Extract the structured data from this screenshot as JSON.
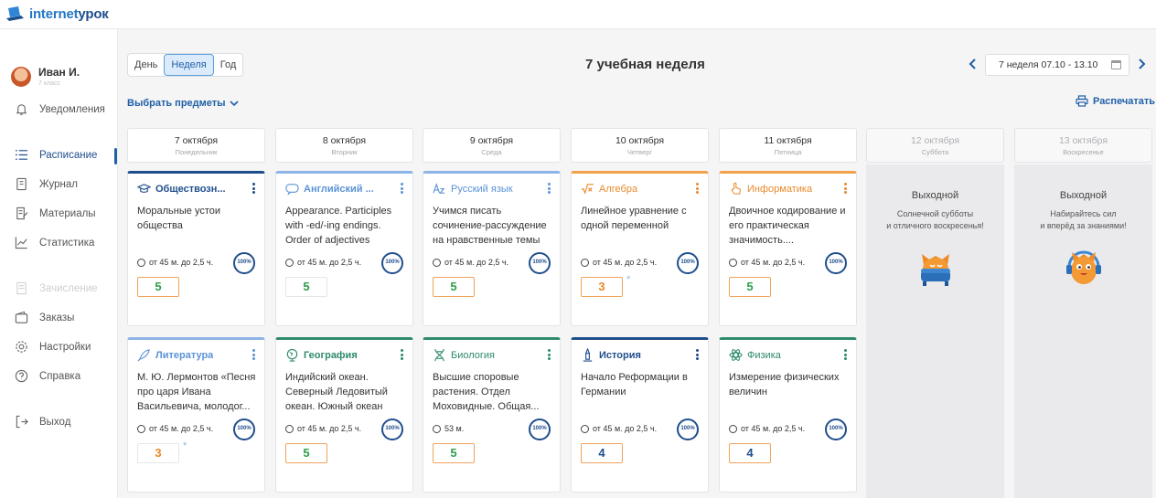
{
  "brand": {
    "name_part1": "internet",
    "name_part2": "урок"
  },
  "user": {
    "name": "Иван И.",
    "class": "7 класс"
  },
  "nav": {
    "notifications": "Уведомления",
    "schedule": "Расписание",
    "journal": "Журнал",
    "materials": "Материалы",
    "statistics": "Статистика",
    "enrollment": "Зачисление",
    "orders": "Заказы",
    "settings": "Настройки",
    "help": "Справка",
    "logout": "Выход"
  },
  "toolbar": {
    "view_day": "День",
    "view_week": "Неделя",
    "view_year": "Год",
    "week_title": "7 учебная неделя",
    "week_range": "7 неделя 07.10 - 13.10",
    "choose_subjects": "Выбрать предметы",
    "print": "Распечатать"
  },
  "days": [
    {
      "date": "7 октября",
      "weekday": "Понедельник"
    },
    {
      "date": "8 октября",
      "weekday": "Вторник"
    },
    {
      "date": "9 октября",
      "weekday": "Среда"
    },
    {
      "date": "10 октября",
      "weekday": "Четверг"
    },
    {
      "date": "11 октября",
      "weekday": "Пятница"
    },
    {
      "date": "12 октября",
      "weekday": "Суббота",
      "off_title": "Выходной",
      "off_line1": "Солнечной субботы",
      "off_line2": "и отличного воскресенья!"
    },
    {
      "date": "13 октября",
      "weekday": "Воскресенье",
      "off_title": "Выходной",
      "off_line1": "Набирайтесь сил",
      "off_line2": "и вперёд за знаниями!"
    }
  ],
  "lessons": {
    "mon1": {
      "subject": "Обществозн...",
      "topic": "Моральные устои общества",
      "duration": "от 45 м. до 2,5 ч.",
      "progress": "100%",
      "grade": "5"
    },
    "mon2": {
      "subject": "Литература",
      "topic": "М. Ю. Лермонтов «Песня про царя Ивана Васильевича, молодог...",
      "duration": "от 45 м. до 2,5 ч.",
      "progress": "100%",
      "grade": "3"
    },
    "tue1": {
      "subject": "Английский ...",
      "topic": "Appearance. Participles with -ed/-ing endings. Order of adjectives",
      "duration": "от 45 м. до 2,5 ч.",
      "progress": "100%",
      "grade": "5"
    },
    "tue2": {
      "subject": "География",
      "topic": "Индийский океан. Северный Ледовитый океан. Южный океан",
      "duration": "от 45 м. до 2,5 ч.",
      "progress": "100%",
      "grade": "5"
    },
    "wed1": {
      "subject": "Русский язык",
      "topic": "Учимся писать сочинение-рассуждение на нравственные темы",
      "duration": "от 45 м. до 2,5 ч.",
      "progress": "100%",
      "grade": "5"
    },
    "wed2": {
      "subject": "Биология",
      "topic": "Высшие споровые растения. Отдел Моховидные. Общая...",
      "duration": "53 м.",
      "progress": "100%",
      "grade": "5"
    },
    "thu1": {
      "subject": "Алгебра",
      "topic": "Линейное уравнение с одной переменной",
      "duration": "от 45 м. до 2,5 ч.",
      "progress": "100%",
      "grade": "3"
    },
    "thu2": {
      "subject": "История",
      "topic": "Начало Реформации в Германии",
      "duration": "от 45 м. до 2,5 ч.",
      "progress": "100%",
      "grade": "4"
    },
    "fri1": {
      "subject": "Информатика",
      "topic": "Двоичное кодирование и его практическая значимость....",
      "duration": "от 45 м. до 2,5 ч.",
      "progress": "100%",
      "grade": "5"
    },
    "fri2": {
      "subject": "Физика",
      "topic": "Измерение физических величин",
      "duration": "от 45 м. до 2,5 ч.",
      "progress": "100%",
      "grade": "4"
    }
  },
  "star_mark": "*",
  "colors": {
    "primary": "#1f4e8c",
    "accent_blue": "#5b93d6",
    "orange": "#f0a14a",
    "green": "#2e8a6e",
    "grade_good": "#2f9e4a"
  }
}
